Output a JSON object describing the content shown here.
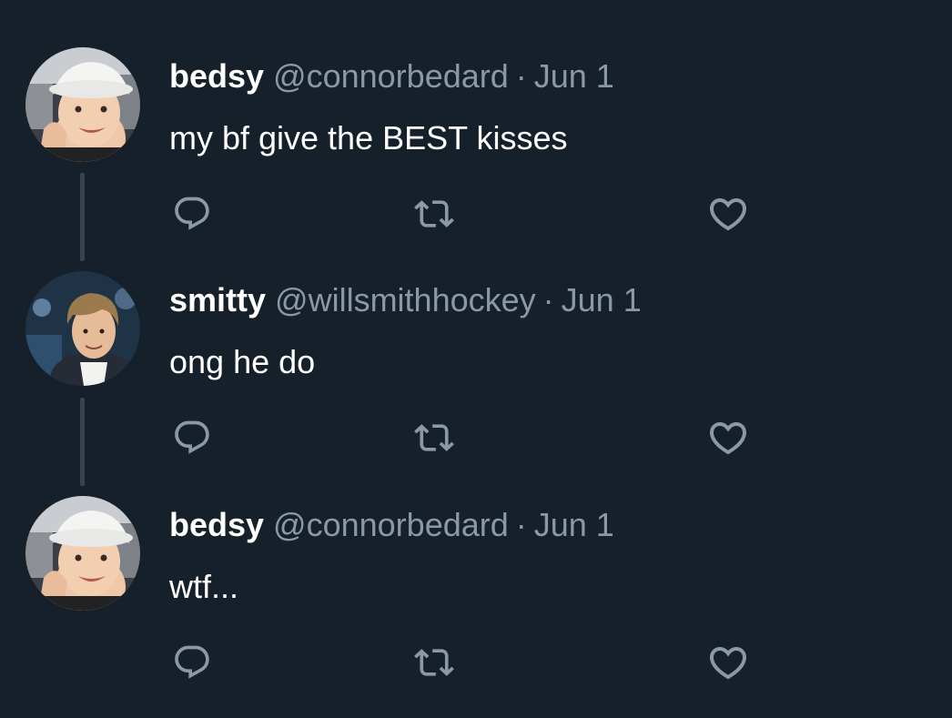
{
  "tweets": [
    {
      "name": "bedsy",
      "handle": "@connorbedard",
      "separator": "·",
      "date": "Jun 1",
      "text": "my bf give the BEST kisses",
      "avatar_icon": "profile-photo-white-bucket-hat"
    },
    {
      "name": "smitty",
      "handle": "@willsmithhockey",
      "separator": "·",
      "date": "Jun 1",
      "text": "ong he do",
      "avatar_icon": "profile-photo-curly-hair"
    },
    {
      "name": "bedsy",
      "handle": "@connorbedard",
      "separator": "·",
      "date": "Jun 1",
      "text": "wtf...",
      "avatar_icon": "profile-photo-white-bucket-hat"
    }
  ],
  "actions": {
    "reply_icon": "reply-icon",
    "retweet_icon": "retweet-icon",
    "like_icon": "heart-icon"
  },
  "colors": {
    "background": "#15202b",
    "primary_text": "#ffffff",
    "secondary_text": "#8b98a5",
    "thread_line": "#38444d"
  }
}
